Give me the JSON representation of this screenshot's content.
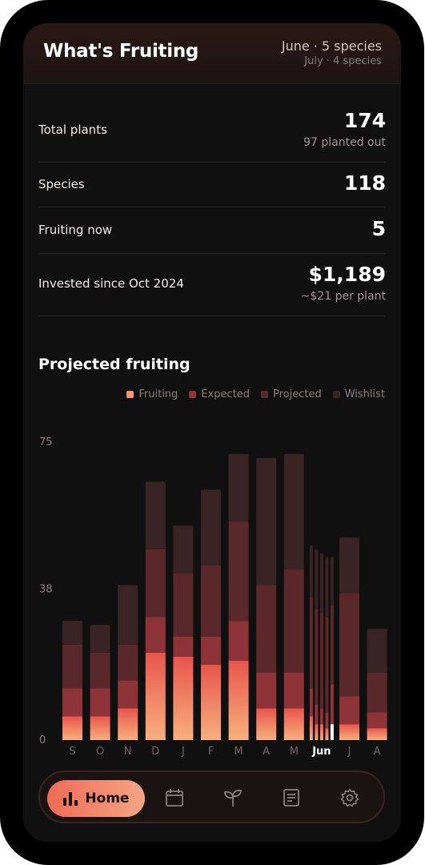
{
  "header": {
    "title": "What's Fruiting",
    "current": "June · 5 species",
    "next": "July · 4 species"
  },
  "stats": [
    {
      "label": "Total plants",
      "value": "174",
      "sub": "97 planted out"
    },
    {
      "label": "Species",
      "value": "118",
      "sub": ""
    },
    {
      "label": "Fruiting now",
      "value": "5",
      "sub": ""
    },
    {
      "label": "Invested since Oct 2024",
      "value": "$1,189",
      "sub": "~$21 per plant"
    }
  ],
  "chart_section": {
    "title": "Projected fruiting"
  },
  "chart_data": {
    "type": "bar",
    "stacked": true,
    "categories": [
      "S",
      "O",
      "N",
      "D",
      "J",
      "F",
      "M",
      "A",
      "M",
      "Jun",
      "J",
      "A"
    ],
    "highlight_category": "Jun",
    "yticks": [
      0,
      38,
      75
    ],
    "ylim": [
      0,
      78
    ],
    "legend": [
      "Fruiting",
      "Expected",
      "Projected",
      "Wishlist"
    ],
    "legend_position": "top-right",
    "colors": {
      "Fruiting": "#f5946f",
      "Expected": "#8e3338",
      "Projected": "#5a282a",
      "Wishlist": "#3a2324"
    },
    "series": [
      {
        "name": "Fruiting",
        "values": [
          6,
          6,
          8,
          22,
          21,
          19,
          20,
          8,
          8,
          4,
          4,
          3
        ]
      },
      {
        "name": "Expected",
        "values": [
          7,
          7,
          7,
          9,
          5,
          7,
          10,
          9,
          9,
          5,
          7,
          4
        ]
      },
      {
        "name": "Projected",
        "values": [
          11,
          9,
          9,
          17,
          16,
          18,
          25,
          22,
          26,
          25,
          26,
          10
        ]
      },
      {
        "name": "Wishlist",
        "values": [
          6,
          7,
          15,
          17,
          12,
          19,
          17,
          32,
          29,
          15,
          14,
          11
        ]
      }
    ],
    "jun_split": [
      {
        "Fruiting": 6,
        "Expected": 7,
        "Projected": 23,
        "Wishlist": 13
      },
      {
        "Fruiting": 4,
        "Expected": 5,
        "Projected": 24,
        "Wishlist": 15
      },
      {
        "Fruiting": 4,
        "Expected": 4,
        "Projected": 24,
        "Wishlist": 15
      },
      {
        "Fruiting": 3,
        "Expected": 4,
        "Projected": 24,
        "Wishlist": 15
      },
      {
        "Fruiting": 4,
        "Expected": 10,
        "Projected": 20,
        "Wishlist": 12
      }
    ]
  },
  "nav": {
    "home_label": "Home",
    "items": [
      "chart-icon",
      "calendar-icon",
      "sprout-icon",
      "list-icon",
      "gear-icon"
    ]
  }
}
